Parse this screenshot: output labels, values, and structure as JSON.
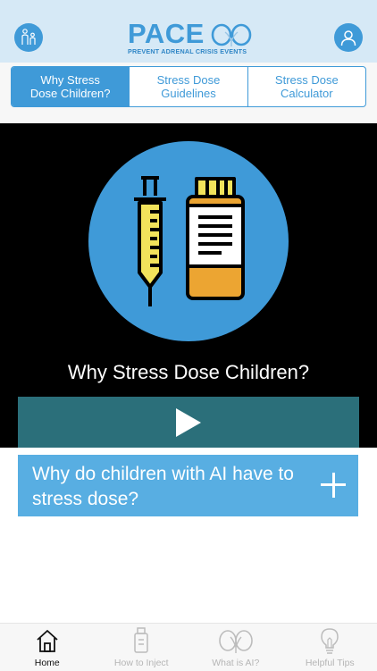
{
  "header": {
    "logo_word": "PACE",
    "logo_tagline": "PREVENT ADRENAL CRISIS EVENTS",
    "left_button_icon": "family-icon",
    "right_button_icon": "user-icon"
  },
  "tabs": [
    {
      "label": "Why Stress\nDose Children?",
      "active": true
    },
    {
      "label": "Stress Dose\nGuidelines",
      "active": false
    },
    {
      "label": "Stress Dose\nCalculator",
      "active": false
    }
  ],
  "hero": {
    "title": "Why Stress Dose Children?",
    "illustration": "syringe-and-medicine-bottle",
    "play_icon": "play-icon"
  },
  "accordion": {
    "question": "Why do children with AI have to stress dose?",
    "toggle_icon": "plus-icon"
  },
  "bottom_nav": [
    {
      "label": "Home",
      "icon": "home-icon",
      "active": true
    },
    {
      "label": "How to Inject",
      "icon": "injector-icon",
      "active": false
    },
    {
      "label": "What is AI?",
      "icon": "kidneys-icon",
      "active": false
    },
    {
      "label": "Helpful Tips",
      "icon": "lightbulb-icon",
      "active": false
    }
  ],
  "colors": {
    "accent": "#3f9ad8",
    "header_bg": "#d6e9f6",
    "play_bar": "#2b6f7a",
    "accordion": "#58aee2"
  }
}
